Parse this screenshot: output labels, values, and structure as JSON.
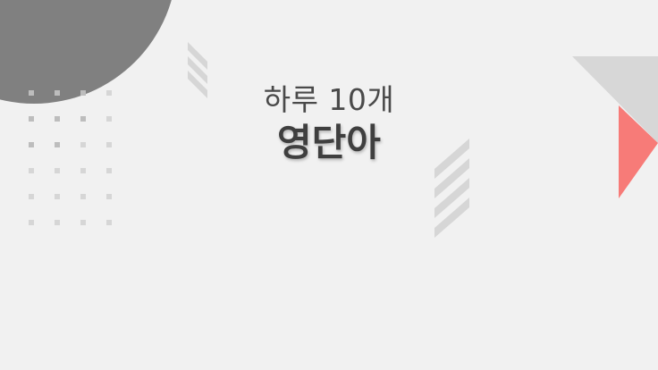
{
  "slide": {
    "title_line1": "하루 10개",
    "title_line2": "영단아"
  },
  "colors": {
    "background": "#f1f1f1",
    "circle": "#808080",
    "dots": "#d6d6d6",
    "stripes": "#d6d6d6",
    "triangle_gray": "#d7d7d7",
    "triangle_red": "#f77b78",
    "text": "#444444"
  }
}
